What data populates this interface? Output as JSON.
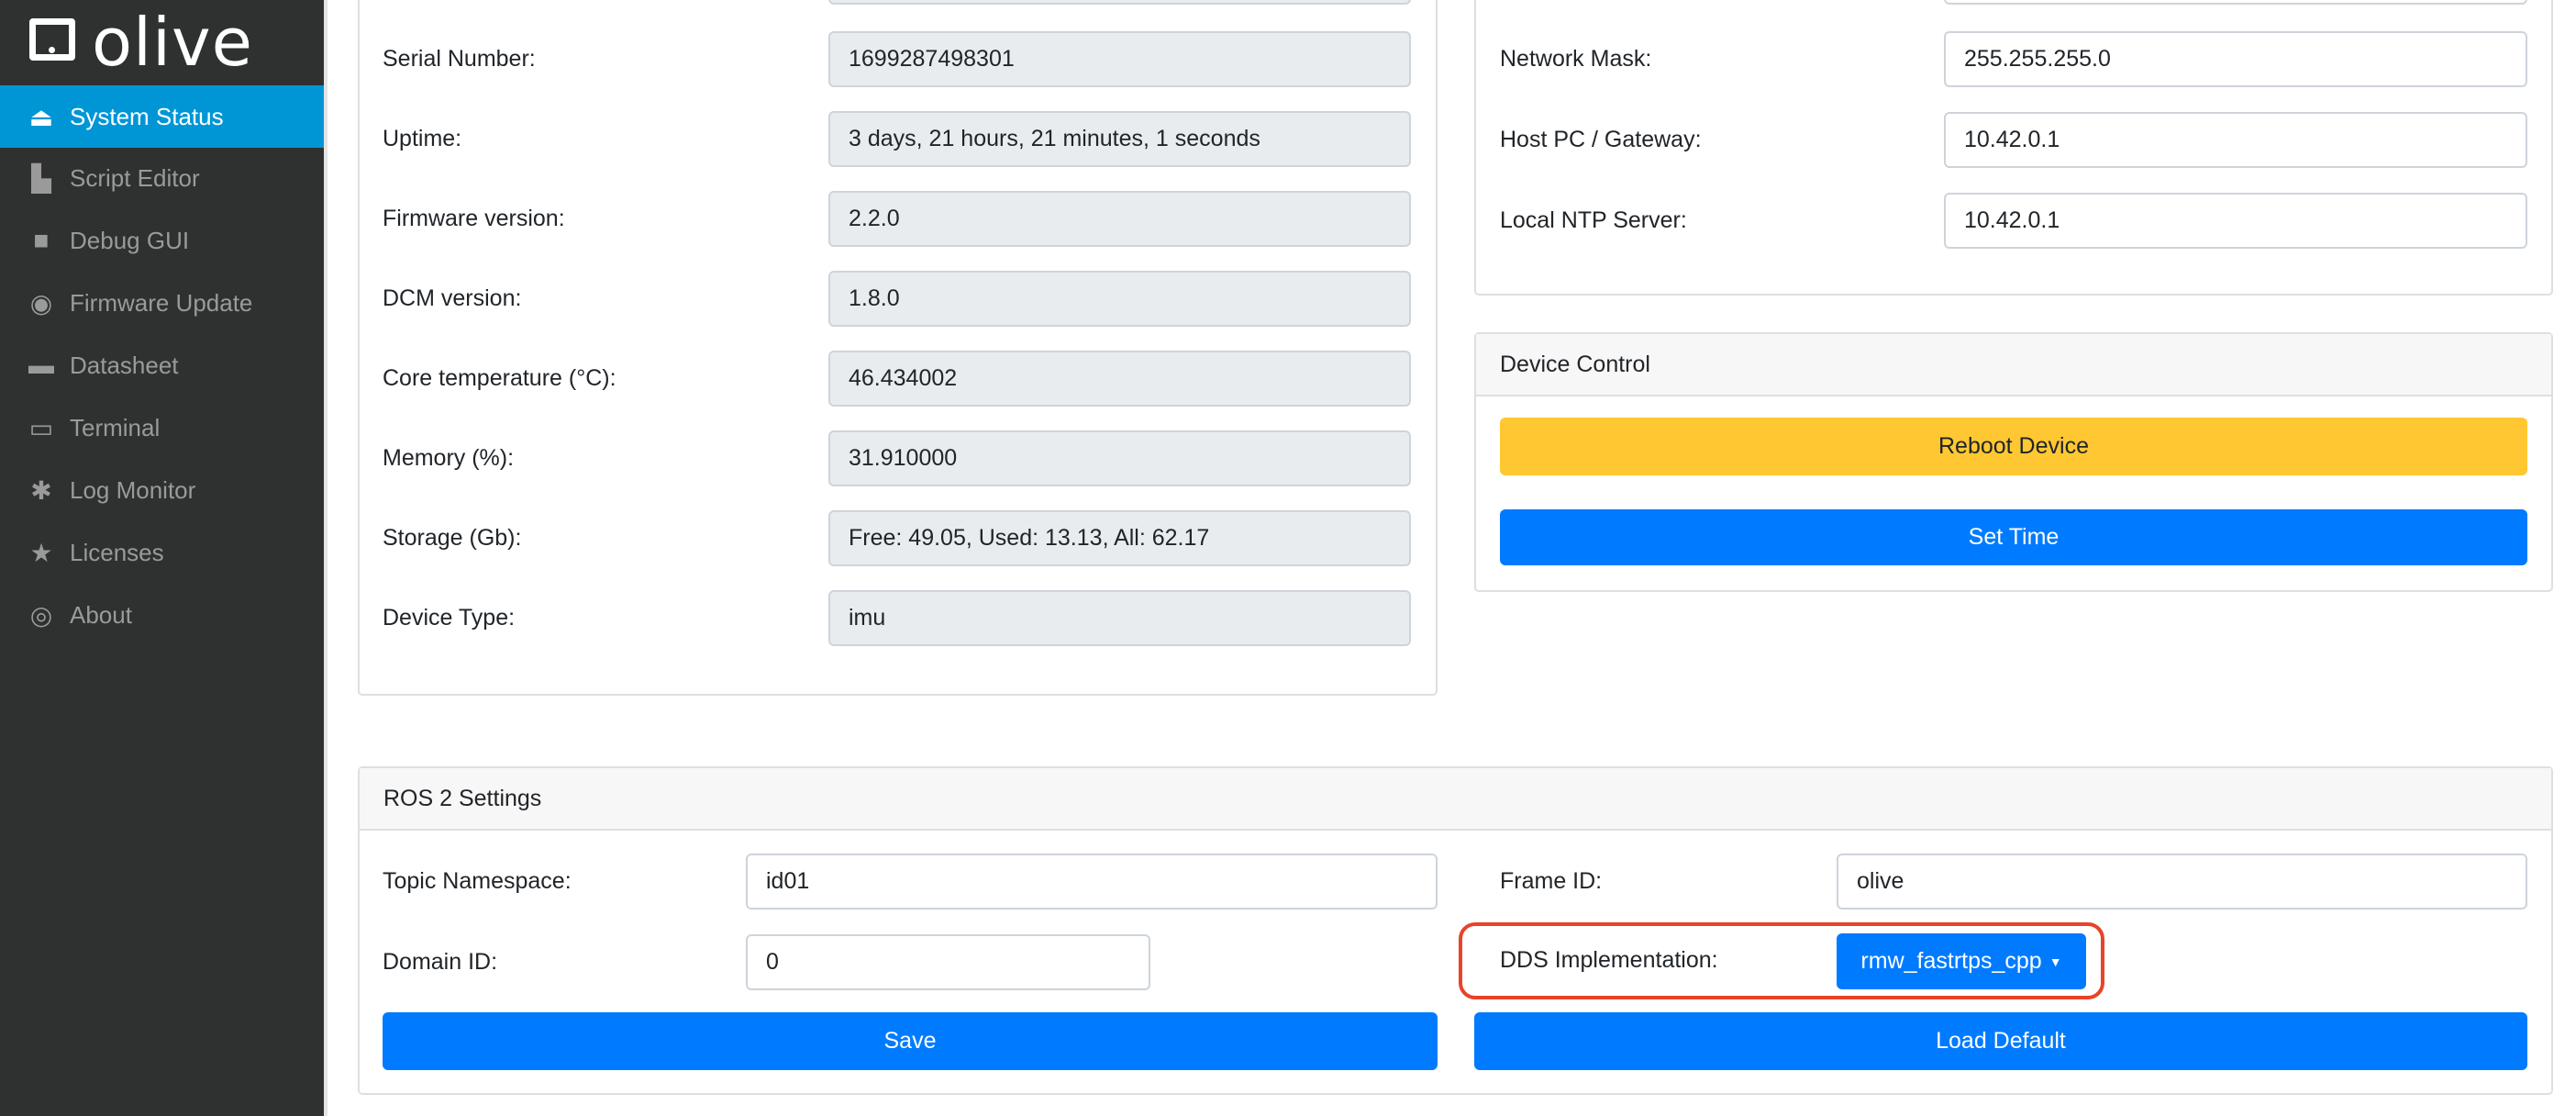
{
  "app": {
    "brand": "olive"
  },
  "sidebar": {
    "items": [
      {
        "label": "System Status",
        "icon": "inbox-icon",
        "active": true
      },
      {
        "label": "Script Editor",
        "icon": "note-icon"
      },
      {
        "label": "Debug GUI",
        "icon": "video-camera-icon"
      },
      {
        "label": "Firmware Update",
        "icon": "disc-icon"
      },
      {
        "label": "Datasheet",
        "icon": "folder-icon"
      },
      {
        "label": "Terminal",
        "icon": "monitor-icon"
      },
      {
        "label": "Log Monitor",
        "icon": "bug-icon"
      },
      {
        "label": "Licenses",
        "icon": "star-icon"
      },
      {
        "label": "About",
        "icon": "fingerprint-icon"
      }
    ]
  },
  "device_info": {
    "rows": [
      {
        "label": "Serial Number:",
        "value": "1699287498301"
      },
      {
        "label": "Uptime:",
        "value": "3 days, 21 hours, 21 minutes, 1 seconds"
      },
      {
        "label": "Firmware version:",
        "value": "2.2.0"
      },
      {
        "label": "DCM version:",
        "value": "1.8.0"
      },
      {
        "label": "Core temperature (°C):",
        "value": "46.434002"
      },
      {
        "label": "Memory (%):",
        "value": "31.910000"
      },
      {
        "label": "Storage (Gb):",
        "value": "Free: 49.05, Used: 13.13, All: 62.17"
      },
      {
        "label": "Device Type:",
        "value": "imu"
      }
    ]
  },
  "network": {
    "rows": [
      {
        "label": "Network Mask:",
        "value": "255.255.255.0"
      },
      {
        "label": "Host PC / Gateway:",
        "value": "10.42.0.1"
      },
      {
        "label": "Local NTP Server:",
        "value": "10.42.0.1"
      }
    ]
  },
  "device_control": {
    "title": "Device Control",
    "reboot": "Reboot Device",
    "set_time": "Set Time"
  },
  "ros2": {
    "title": "ROS 2 Settings",
    "topic_namespace_label": "Topic Namespace:",
    "topic_namespace": "id01",
    "frame_id_label": "Frame ID:",
    "frame_id": "olive",
    "domain_id_label": "Domain ID:",
    "domain_id": "0",
    "dds_label": "DDS Implementation:",
    "dds_value": "rmw_fastrtps_cpp",
    "save": "Save",
    "load_default": "Load Default"
  },
  "colors": {
    "sidebar": "#2f3131",
    "active": "#0096d6",
    "primary": "#007bff",
    "warning": "#ffc832",
    "highlight": "#e8432a"
  }
}
